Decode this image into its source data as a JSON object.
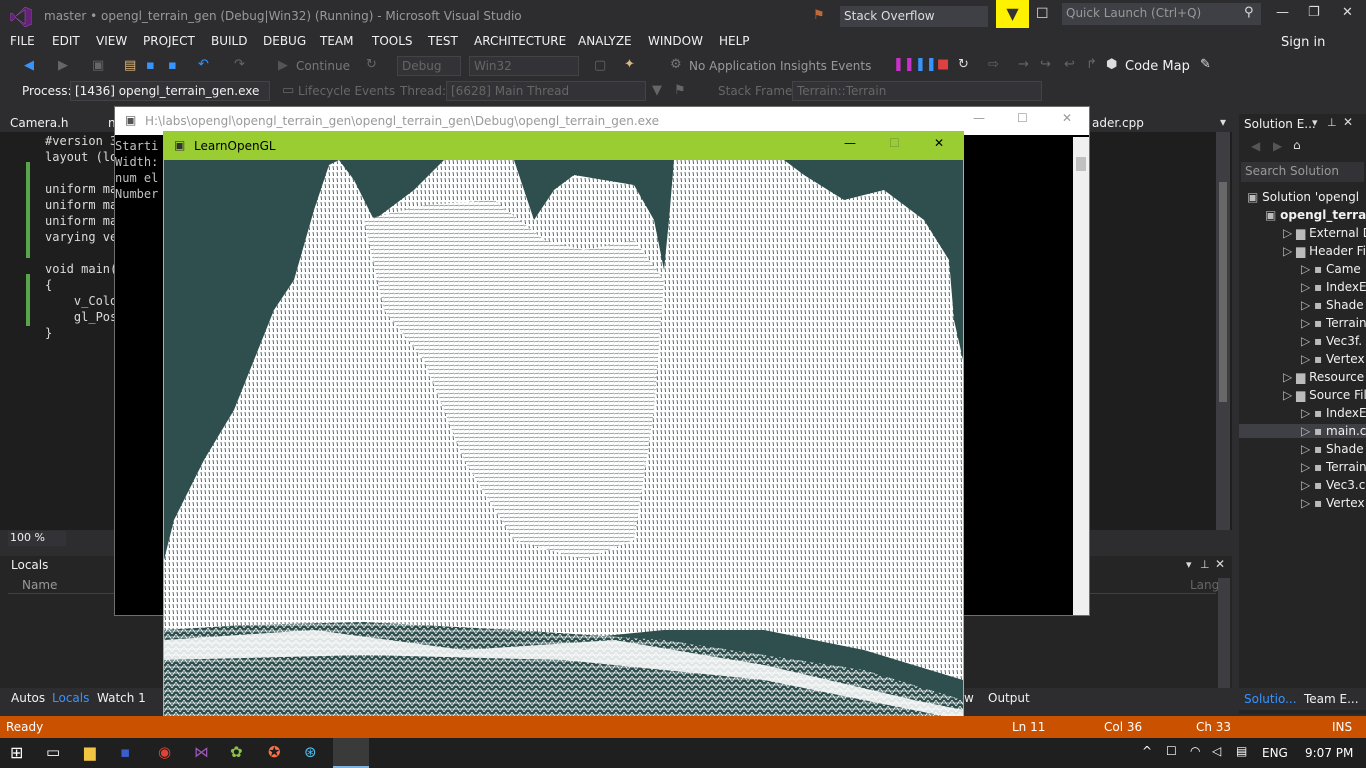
{
  "titlebar": {
    "title": "master • opengl_terrain_gen (Debug|Win32) (Running) - Microsoft Visual Studio",
    "search_scope": "Stack Overflow",
    "quick_launch_placeholder": "Quick Launch (Ctrl+Q)"
  },
  "menu": [
    "FILE",
    "EDIT",
    "VIEW",
    "PROJECT",
    "BUILD",
    "DEBUG",
    "TEAM",
    "TOOLS",
    "TEST",
    "ARCHITECTURE",
    "ANALYZE",
    "WINDOW",
    "HELP"
  ],
  "signin": "Sign in",
  "toolbar1": {
    "continue_label": "Continue",
    "config": "Debug",
    "platform": "Win32",
    "insights": "No Application Insights Events",
    "codemap": "Code Map"
  },
  "toolbar2": {
    "process_label": "Process:",
    "process_value": "[1436] opengl_terrain_gen.exe",
    "lifecycle": "Lifecycle Events",
    "thread_label": "Thread:",
    "thread_value": "[6628] Main Thread",
    "stackframe_label": "Stack Frame:",
    "stackframe_value": "Terrain::Terrain"
  },
  "tabs": {
    "left": "Camera.h",
    "left2": "n",
    "right": "ader.cpp"
  },
  "code_lines": [
    "#version 3",
    "layout (lo",
    "",
    "uniform ma",
    "uniform ma",
    "uniform ma",
    "varying ve",
    "",
    "void main(",
    "{",
    "    v_Colo",
    "    gl_Pos",
    "}"
  ],
  "zoom": "100 %",
  "locals": {
    "title": "Locals",
    "col_name": "Name",
    "col_type": "Lang"
  },
  "bottom_tabs": [
    "Autos",
    "Locals",
    "Watch 1"
  ],
  "bottom_tabs_right": [
    "w",
    "Output"
  ],
  "status": {
    "ready": "Ready",
    "ln": "Ln 11",
    "col": "Col 36",
    "ch": "Ch 33",
    "ins": "INS"
  },
  "console": {
    "path": "H:\\labs\\opengl\\opengl_terrain_gen\\opengl_terrain_gen\\Debug\\opengl_terrain_gen.exe",
    "lines": [
      "Starti",
      "Width:",
      "num el",
      "Number"
    ]
  },
  "gl_window": {
    "title": "LearnOpenGL"
  },
  "solution": {
    "header": "Solution E...",
    "search": "Search Solution",
    "items": [
      {
        "label": "Solution 'opengl",
        "indent": 0
      },
      {
        "label": "opengl_terra",
        "indent": 1
      },
      {
        "label": "External D",
        "indent": 2
      },
      {
        "label": "Header Fi",
        "indent": 2
      },
      {
        "label": "Came",
        "indent": 3
      },
      {
        "label": "IndexE",
        "indent": 3
      },
      {
        "label": "Shade",
        "indent": 3
      },
      {
        "label": "Terrain",
        "indent": 3
      },
      {
        "label": "Vec3f.",
        "indent": 3
      },
      {
        "label": "Vertex",
        "indent": 3
      },
      {
        "label": "Resource",
        "indent": 2
      },
      {
        "label": "Source Fil",
        "indent": 2
      },
      {
        "label": "IndexE",
        "indent": 3
      },
      {
        "label": "main.c",
        "indent": 3
      },
      {
        "label": "Shade",
        "indent": 3
      },
      {
        "label": "Terrain",
        "indent": 3
      },
      {
        "label": "Vec3.c",
        "indent": 3
      },
      {
        "label": "Vertex",
        "indent": 3
      }
    ],
    "tab1": "Solutio...",
    "tab2": "Team E..."
  },
  "taskbar": {
    "lang": "ENG",
    "time": "9:07 PM"
  },
  "colors": {
    "accent_status": "#ca5100",
    "gl_title": "#9acd32",
    "gl_bg": "#2f4f4f"
  }
}
